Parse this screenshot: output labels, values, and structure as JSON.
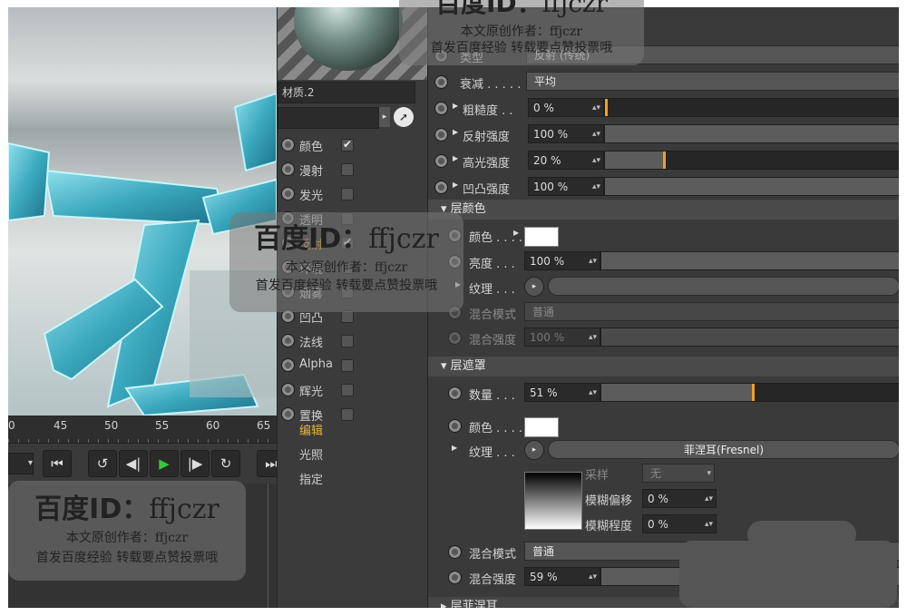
{
  "timeline": {
    "ticks": [
      "0",
      "45",
      "50",
      "55",
      "60",
      "65"
    ]
  },
  "transport": {
    "buttons": [
      "⏮",
      "↺",
      "◀|",
      "▶",
      "|▶",
      "↻",
      "⏭"
    ]
  },
  "material": {
    "name": "材质.2",
    "channels": [
      {
        "label": "颜色",
        "checked": true
      },
      {
        "label": "漫射",
        "checked": false
      },
      {
        "label": "发光",
        "checked": false
      },
      {
        "label": "透明",
        "checked": false
      },
      {
        "label": "反射",
        "checked": true,
        "active": true
      },
      {
        "label": "环境",
        "checked": false
      },
      {
        "label": "烟雾",
        "checked": false
      },
      {
        "label": "凹凸",
        "checked": false
      },
      {
        "label": "法线",
        "checked": false
      },
      {
        "label": "Alpha",
        "checked": false
      },
      {
        "label": "辉光",
        "checked": false
      },
      {
        "label": "置换",
        "checked": false
      }
    ],
    "subnav": [
      "编辑",
      "光照",
      "指定"
    ]
  },
  "attributes": {
    "type_label": "类型",
    "type_value": "反射 (传统)",
    "falloff_label": "衰减 . . . . .",
    "falloff_value": "平均",
    "roughness_label": "粗糙度 . .",
    "roughness_value": "0 %",
    "roughness_pct": 0,
    "refl_label": "反射强度",
    "refl_value": "100 %",
    "refl_pct": 100,
    "spec_label": "高光强度",
    "spec_value": "20 %",
    "spec_pct": 20,
    "bump_label": "凹凸强度",
    "bump_value": "100 %",
    "bump_pct": 100,
    "layer_color_section": "▾ 层颜色",
    "lc_color_label": "颜色 . . . .",
    "lc_brightness_label": "亮度 . . .",
    "lc_brightness_value": "100 %",
    "lc_brightness_pct": 100,
    "lc_texture_label": "纹理 . . .",
    "lc_blend_mode_label": "混合模式",
    "lc_blend_mode_value": "普通",
    "lc_blend_strength_label": "混合强度",
    "lc_blend_strength_value": "100 %",
    "lc_blend_strength_pct": 100,
    "layer_mask_section": "▾ 层遮罩",
    "lm_amount_label": "数量 . . .",
    "lm_amount_value": "51 %",
    "lm_amount_pct": 51,
    "lm_color_label": "颜色 . . . .",
    "lm_texture_label": "纹理 . . .",
    "lm_texture_value": "菲涅耳(Fresnel)",
    "sample_label": "采样",
    "sample_value": "无",
    "blur_offset_label": "模糊偏移",
    "blur_offset_value": "0 %",
    "blur_scale_label": "模糊程度",
    "blur_scale_value": "0 %",
    "lm_blend_mode_label": "混合模式",
    "lm_blend_mode_value": "普通",
    "lm_blend_strength_label": "混合强度",
    "lm_blend_strength_value": "59 %",
    "lm_blend_strength_pct": 59,
    "next_section": "▸ 层菲涅耳"
  },
  "watermark": {
    "big": "百度ID：",
    "id": "ffjczr",
    "line1": "本文原创作者：ffjczr",
    "line2": "首发百度经验  转载要点赞投票哦"
  }
}
